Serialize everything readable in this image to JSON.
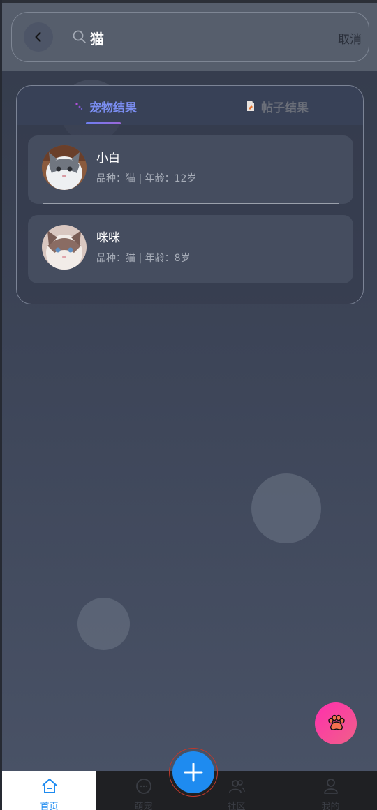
{
  "search": {
    "query": "猫",
    "cancel_label": "取消"
  },
  "tabs": [
    {
      "label": "宠物结果",
      "active": true
    },
    {
      "label": "帖子结果",
      "active": false
    }
  ],
  "pets": [
    {
      "name": "小白",
      "meta": "品种：猫 | 年龄：12岁"
    },
    {
      "name": "咪咪",
      "meta": "品种：猫 | 年龄：8岁"
    }
  ],
  "nav": {
    "items": [
      {
        "label": "首页",
        "active": true
      },
      {
        "label": "萌宠"
      },
      {
        "label": "社区"
      },
      {
        "label": "我的"
      }
    ]
  },
  "colors": {
    "accent": "#1e8bf0",
    "active_tab": "#7b8ef2",
    "paw_button": "#ff2fae"
  }
}
